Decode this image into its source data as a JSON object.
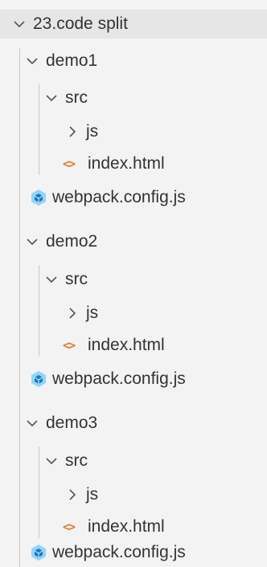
{
  "explorer": {
    "root": {
      "label": "23.code split",
      "expanded": true,
      "icon": "chevron-down-icon"
    },
    "demos": [
      {
        "label": "demo1",
        "expanded": true,
        "src": {
          "label": "src",
          "expanded": true
        },
        "js": {
          "label": "js",
          "expanded": false
        },
        "index": {
          "label": "index.html",
          "icon": "html-file-icon"
        },
        "config": {
          "label": "webpack.config.js",
          "icon": "webpack-icon"
        }
      },
      {
        "label": "demo2",
        "expanded": true,
        "src": {
          "label": "src",
          "expanded": true
        },
        "js": {
          "label": "js",
          "expanded": false
        },
        "index": {
          "label": "index.html",
          "icon": "html-file-icon"
        },
        "config": {
          "label": "webpack.config.js",
          "icon": "webpack-icon"
        }
      },
      {
        "label": "demo3",
        "expanded": true,
        "src": {
          "label": "src",
          "expanded": true
        },
        "js": {
          "label": "js",
          "expanded": false
        },
        "index": {
          "label": "index.html",
          "icon": "html-file-icon"
        },
        "config": {
          "label": "webpack.config.js",
          "icon": "webpack-icon"
        }
      }
    ],
    "colors": {
      "background": "#f3f3f3",
      "root_highlight": "#e6e6e6",
      "text": "#333333",
      "html_icon": "#e37933",
      "webpack_icon": "#4a8fd6",
      "indent_guide": "#c8c8c8"
    }
  }
}
